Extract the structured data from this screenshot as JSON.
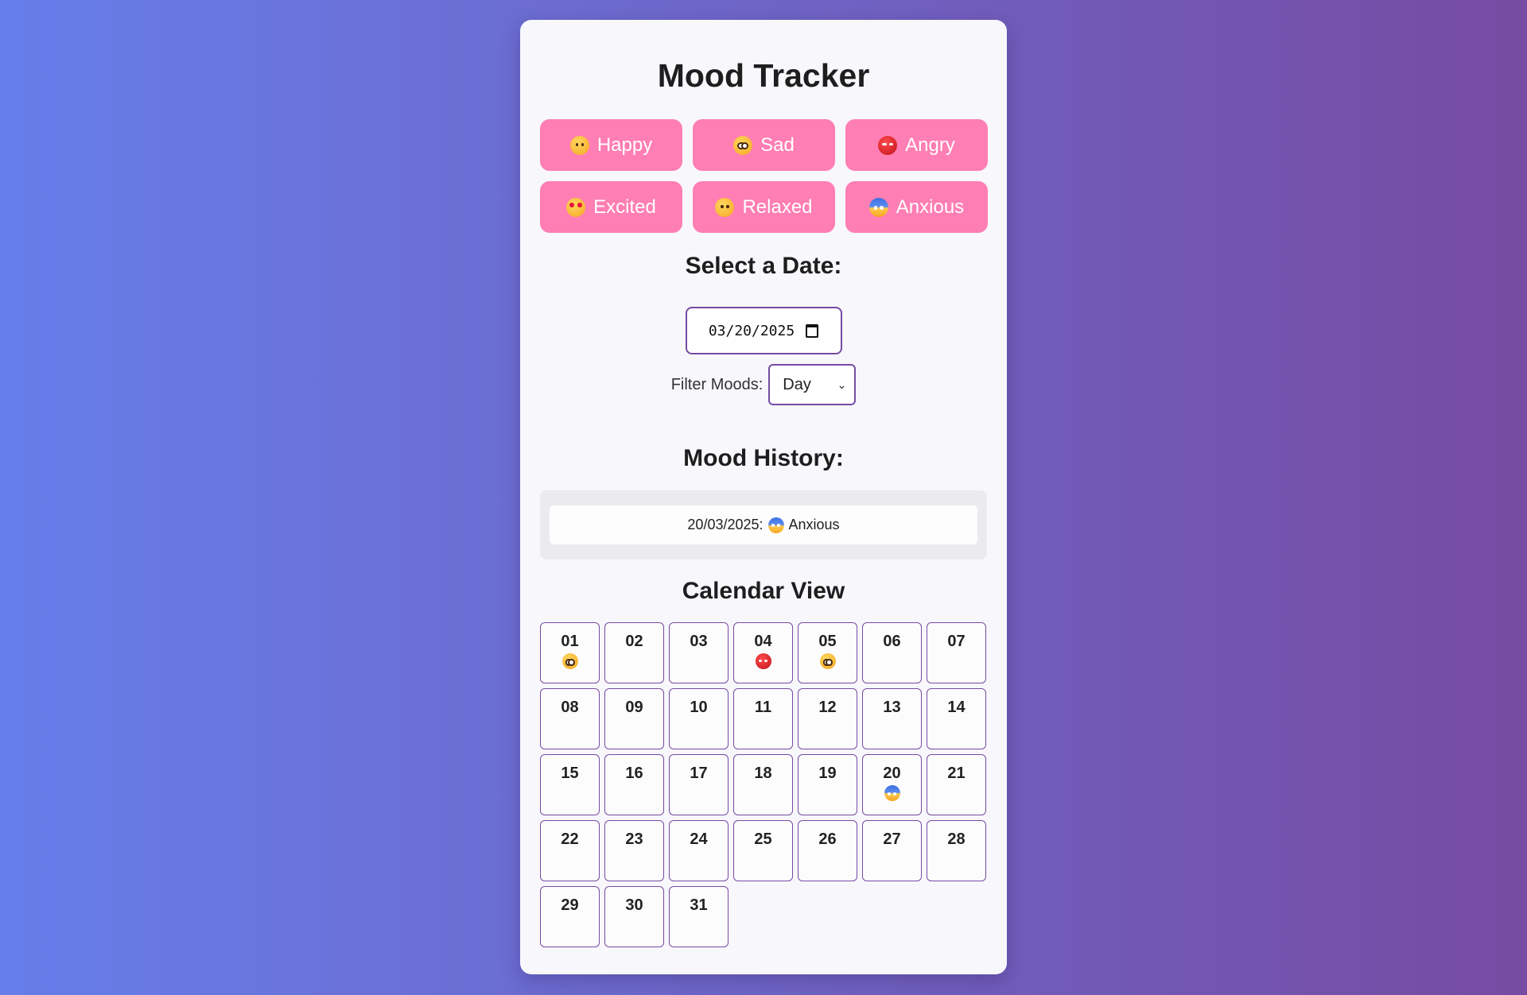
{
  "app": {
    "title": "Mood Tracker"
  },
  "moods": [
    {
      "label": "Happy",
      "icon": "smiling-face-icon",
      "emoji_class": "e-happy"
    },
    {
      "label": "Sad",
      "icon": "sad-face-icon",
      "emoji_class": "e-sad"
    },
    {
      "label": "Angry",
      "icon": "angry-face-icon",
      "emoji_class": "e-angry"
    },
    {
      "label": "Excited",
      "icon": "star-struck-face-icon",
      "emoji_class": "e-excited"
    },
    {
      "label": "Relaxed",
      "icon": "relieved-face-icon",
      "emoji_class": "e-relaxed"
    },
    {
      "label": "Anxious",
      "icon": "fearful-face-icon",
      "emoji_class": "e-anxious"
    }
  ],
  "date_section": {
    "heading": "Select a Date:",
    "value": "03/20/2025",
    "filter_label": "Filter Moods:",
    "filter_value": "Day"
  },
  "history": {
    "heading": "Mood History:",
    "items": [
      {
        "date": "20/03/2025:",
        "mood": "Anxious",
        "emoji_class": "e-anxious"
      }
    ]
  },
  "calendar": {
    "heading": "Calendar View",
    "days": [
      {
        "num": "01",
        "mood": "e-sad"
      },
      {
        "num": "02"
      },
      {
        "num": "03"
      },
      {
        "num": "04",
        "mood": "e-angry"
      },
      {
        "num": "05",
        "mood": "e-sad"
      },
      {
        "num": "06"
      },
      {
        "num": "07"
      },
      {
        "num": "08"
      },
      {
        "num": "09"
      },
      {
        "num": "10"
      },
      {
        "num": "11"
      },
      {
        "num": "12"
      },
      {
        "num": "13"
      },
      {
        "num": "14"
      },
      {
        "num": "15"
      },
      {
        "num": "16"
      },
      {
        "num": "17"
      },
      {
        "num": "18"
      },
      {
        "num": "19"
      },
      {
        "num": "20",
        "mood": "e-anxious"
      },
      {
        "num": "21"
      },
      {
        "num": "22"
      },
      {
        "num": "23"
      },
      {
        "num": "24"
      },
      {
        "num": "25"
      },
      {
        "num": "26"
      },
      {
        "num": "27"
      },
      {
        "num": "28"
      },
      {
        "num": "29"
      },
      {
        "num": "30"
      },
      {
        "num": "31"
      }
    ]
  },
  "colors": {
    "background_start": "#667eea",
    "background_end": "#764ba2",
    "mood_button": "#ff7eb3",
    "border_accent": "#764ba2"
  }
}
